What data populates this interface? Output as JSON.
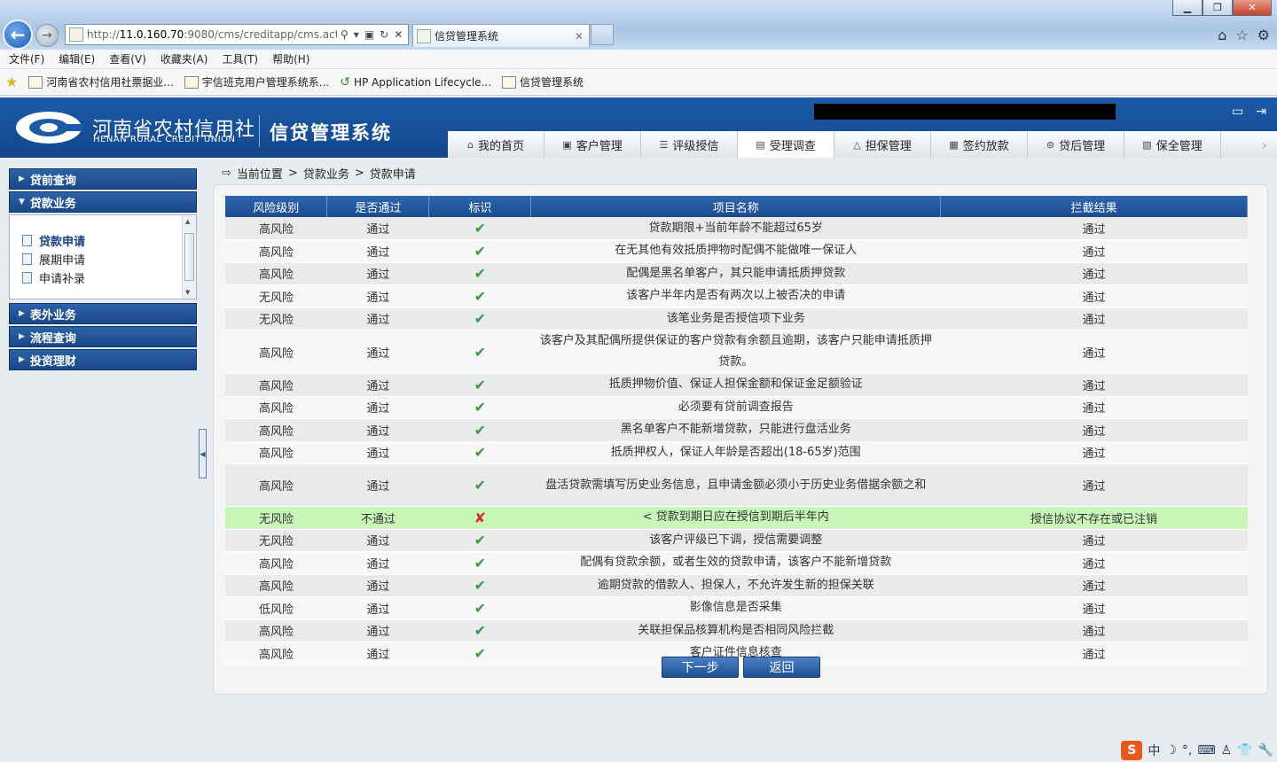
{
  "browser": {
    "url_prefix": "http://",
    "url_host": "11.0.160.70",
    "url_rest": ":9080/cms/creditapp/cms.actic",
    "tab_title": "信贷管理系统",
    "menu": [
      "文件(F)",
      "编辑(E)",
      "查看(V)",
      "收藏夹(A)",
      "工具(T)",
      "帮助(H)"
    ],
    "favorites": [
      "河南省农村信用社票据业...",
      "宇信班克用户管理系统系...",
      "HP Application Lifecycle...",
      "信贷管理系统"
    ]
  },
  "header": {
    "org_cn": "河南省农村信用社",
    "org_en": "HENAN RURAL CREDIT UNION",
    "system_title": "信贷管理系统",
    "nav": [
      {
        "label": "我的首页",
        "icon": "home-icon"
      },
      {
        "label": "客户管理",
        "icon": "customer-icon"
      },
      {
        "label": "评级授信",
        "icon": "rating-icon"
      },
      {
        "label": "受理调查",
        "icon": "survey-icon",
        "active": true
      },
      {
        "label": "担保管理",
        "icon": "guarantee-icon"
      },
      {
        "label": "签约放款",
        "icon": "contract-icon"
      },
      {
        "label": "贷后管理",
        "icon": "post-loan-icon"
      },
      {
        "label": "保全管理",
        "icon": "preservation-icon"
      }
    ]
  },
  "sidebar": {
    "groups": [
      "贷前查询",
      "贷款业务",
      "表外业务",
      "流程查询",
      "投资理财"
    ],
    "loan_items": [
      "贷款申请",
      "展期申请",
      "申请补录"
    ]
  },
  "breadcrumb": {
    "label": "当前位置",
    "sep": ">",
    "path": [
      "贷款业务",
      "贷款申请"
    ]
  },
  "table": {
    "headers": [
      "风险级别",
      "是否通过",
      "标识",
      "项目名称",
      "拦截结果"
    ],
    "rows": [
      {
        "risk": "高风险",
        "pass": "通过",
        "mark": "✔",
        "name": "贷款期限+当前年龄不能超过65岁",
        "result": "通过"
      },
      {
        "risk": "高风险",
        "pass": "通过",
        "mark": "✔",
        "name": "在无其他有效抵质押物时配偶不能做唯一保证人",
        "result": "通过"
      },
      {
        "risk": "高风险",
        "pass": "通过",
        "mark": "✔",
        "name": "配偶是黑名单客户，其只能申请抵质押贷款",
        "result": "通过"
      },
      {
        "risk": "无风险",
        "pass": "通过",
        "mark": "✔",
        "name": "该客户半年内是否有两次以上被否决的申请",
        "result": "通过"
      },
      {
        "risk": "无风险",
        "pass": "通过",
        "mark": "✔",
        "name": "该笔业务是否授信项下业务",
        "result": "通过"
      },
      {
        "risk": "高风险",
        "pass": "通过",
        "mark": "✔",
        "name": "该客户及其配偶所提供保证的客户贷款有余额且逾期，该客户只能申请抵质押贷款。",
        "result": "通过"
      },
      {
        "risk": "高风险",
        "pass": "通过",
        "mark": "✔",
        "name": "抵质押物价值、保证人担保金额和保证金足额验证",
        "result": "通过"
      },
      {
        "risk": "高风险",
        "pass": "通过",
        "mark": "✔",
        "name": "必须要有贷前调查报告",
        "result": "通过"
      },
      {
        "risk": "高风险",
        "pass": "通过",
        "mark": "✔",
        "name": "黑名单客户不能新增贷款，只能进行盘活业务",
        "result": "通过"
      },
      {
        "risk": "高风险",
        "pass": "通过",
        "mark": "✔",
        "name": "抵质押权人，保证人年龄是否超出(18-65岁)范围",
        "result": "通过"
      },
      {
        "risk": "高风险",
        "pass": "通过",
        "mark": "✔",
        "name": "盘活贷款需填写历史业务信息，且申请金额必须小于历史业务借据余额之和",
        "result": "通过"
      },
      {
        "risk": "无风险",
        "pass": "不通过",
        "mark": "✘",
        "name": "< 贷款到期日应在授信到期后半年内",
        "result": "授信协议不存在或已注销",
        "fail": true
      },
      {
        "risk": "无风险",
        "pass": "通过",
        "mark": "✔",
        "name": "该客户评级已下调，授信需要调整",
        "result": "通过"
      },
      {
        "risk": "高风险",
        "pass": "通过",
        "mark": "✔",
        "name": "配偶有贷款余额，或者生效的贷款申请，该客户不能新增贷款",
        "result": "通过"
      },
      {
        "risk": "高风险",
        "pass": "通过",
        "mark": "✔",
        "name": "逾期贷款的借款人、担保人，不允许发生新的担保关联",
        "result": "通过"
      },
      {
        "risk": "低风险",
        "pass": "通过",
        "mark": "✔",
        "name": "影像信息是否采集",
        "result": "通过"
      },
      {
        "risk": "高风险",
        "pass": "通过",
        "mark": "✔",
        "name": "关联担保品核算机构是否相同风险拦截",
        "result": "通过"
      },
      {
        "risk": "高风险",
        "pass": "通过",
        "mark": "✔",
        "name": "客户证件信息核查",
        "result": "通过"
      }
    ]
  },
  "buttons": {
    "next": "下一步",
    "back": "返回"
  },
  "ime": {
    "lang": "中",
    "moon": "☽",
    "punct": "°,",
    "keyboard": "⌨",
    "user": "♙",
    "shirt": "👕",
    "tool": "🔧"
  },
  "colors": {
    "header_blue": "#1c5aa8",
    "pass_green": "#3c9a3a",
    "fail_red": "#d2322d",
    "fail_row_bg": "#c8f7b9"
  }
}
